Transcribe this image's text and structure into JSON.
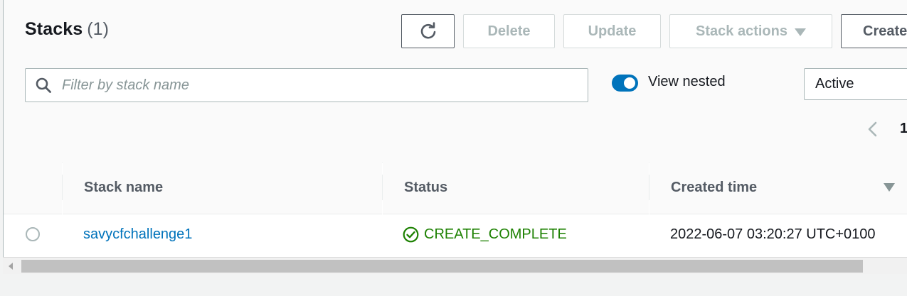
{
  "header": {
    "title": "Stacks",
    "count": "(1)"
  },
  "toolbar": {
    "refresh_icon": "refresh-icon",
    "delete_label": "Delete",
    "update_label": "Update",
    "stack_actions_label": "Stack actions",
    "create_label": "Create"
  },
  "filter": {
    "placeholder": "Filter by stack name",
    "value": ""
  },
  "view_nested": {
    "label": "View nested",
    "enabled": true
  },
  "status_filter": {
    "selected": "Active"
  },
  "pagination": {
    "current_page": "1"
  },
  "table": {
    "columns": [
      "Stack name",
      "Status",
      "Created time"
    ],
    "rows": [
      {
        "name": "savycfchallenge1",
        "status": "CREATE_COMPLETE",
        "created": "2022-06-07 03:20:27 UTC+0100"
      }
    ]
  },
  "colors": {
    "accent": "#0073bb",
    "success": "#1d8102",
    "disabled_text": "#aab7b8"
  }
}
